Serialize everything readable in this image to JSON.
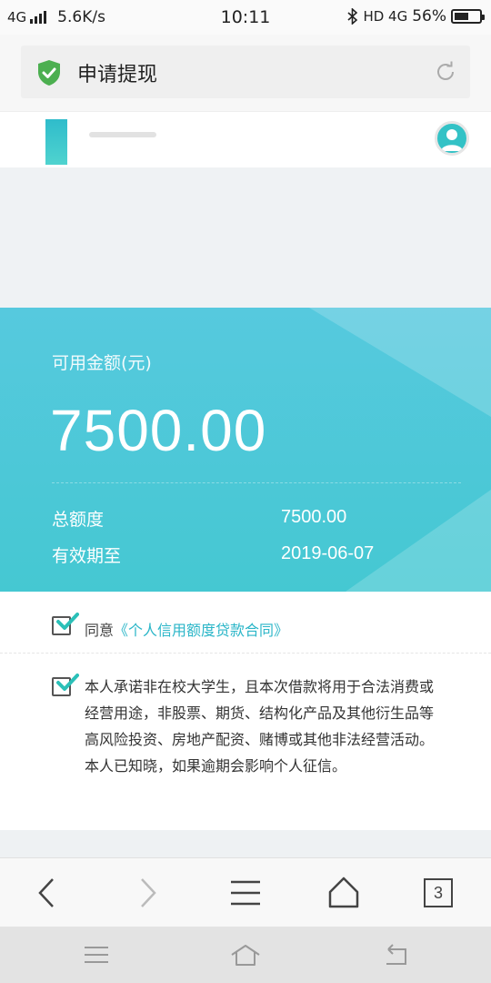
{
  "status_bar": {
    "network": "4G",
    "speed": "5.6K/s",
    "time": "10:11",
    "network_right": "HD 4G",
    "battery_text": "56%",
    "battery_level": 0.56
  },
  "title_bar": {
    "title": "申请提现",
    "icons": [
      "shield-check-icon",
      "refresh-icon"
    ]
  },
  "card": {
    "label": "可用金额(元)",
    "amount": "7500.00",
    "rows": [
      {
        "label": "总额度",
        "value": "7500.00"
      },
      {
        "label": "有效期至",
        "value": "2019-06-07"
      }
    ]
  },
  "agreements": {
    "agree_prefix": "同意",
    "agree_link": "《个人信用额度贷款合同》",
    "promise_text": "本人承诺非在校大学生，且本次借款将用于合法消费或经营用途，非股票、期货、结构化产品及其他衍生品等高风险投资、房地产配资、赌博或其他非法经营活动。本人已知晓，如果逾期会影响个人征信。"
  },
  "browser_bar": {
    "tabs_count": "3",
    "icons": [
      "back-icon",
      "forward-icon",
      "menu-icon",
      "home-icon",
      "tabs-icon"
    ]
  },
  "colors": {
    "card_bg": "#4cc8d8",
    "link": "#2bb6c8",
    "check": "#2bc0b8",
    "shield": "#4caf50"
  }
}
